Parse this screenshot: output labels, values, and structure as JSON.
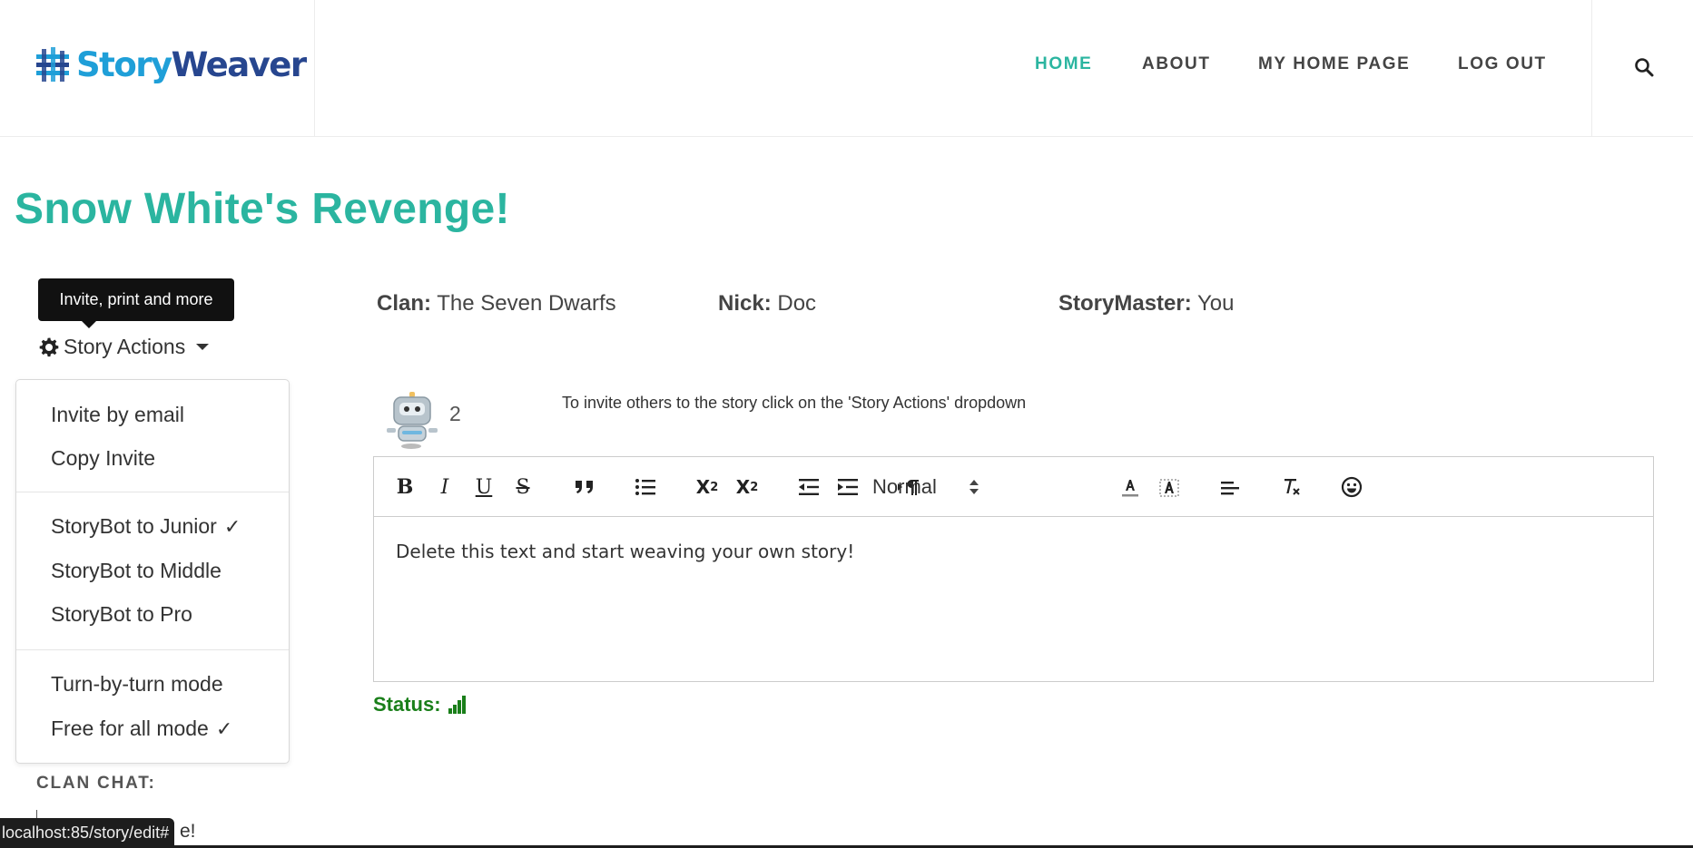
{
  "header": {
    "logo": {
      "part1": "Story",
      "part2": "Weaver"
    },
    "nav": [
      {
        "label": "HOME",
        "active": true
      },
      {
        "label": "ABOUT",
        "active": false
      },
      {
        "label": "MY HOME PAGE",
        "active": false
      },
      {
        "label": "LOG OUT",
        "active": false
      }
    ],
    "search_icon": "search-icon"
  },
  "page": {
    "title": "Snow White's Revenge!"
  },
  "tooltip": {
    "text": "Invite, print and more"
  },
  "story_actions": {
    "label": "Story Actions",
    "menu": {
      "group1": [
        "Invite by email",
        "Copy Invite"
      ],
      "group2": [
        {
          "label": "StoryBot to Junior",
          "checked": true
        },
        {
          "label": "StoryBot to Middle",
          "checked": false
        },
        {
          "label": "StoryBot to Pro",
          "checked": false
        }
      ],
      "group3": [
        {
          "label": "Turn-by-turn mode",
          "checked": false
        },
        {
          "label": "Free for all mode",
          "checked": true
        }
      ],
      "check_mark": "✓"
    }
  },
  "clan_chat": {
    "heading": "CLAN CHAT:",
    "partial_text": "e!"
  },
  "status_url": "localhost:85/story/edit#",
  "info": {
    "clan_label": "Clan:",
    "clan_value": "The Seven Dwarfs",
    "nick_label": "Nick:",
    "nick_value": "Doc",
    "master_label": "StoryMaster:",
    "master_value": "You"
  },
  "bot": {
    "count": "2",
    "icon": "robot-icon"
  },
  "invite_hint": "To invite others to the story click on the 'Story Actions' dropdown",
  "editor": {
    "toolbar": {
      "bold": "B",
      "italic": "I",
      "underline": "U",
      "strike": "S",
      "subscript_base": "X",
      "subscript_mark": "2",
      "superscript_base": "X",
      "superscript_mark": "2",
      "size_value": "Normal"
    },
    "content": "Delete this text and start weaving your own story!"
  },
  "status": {
    "label": "Status:",
    "icon": "signal-bars-icon"
  },
  "colors": {
    "accent": "#2bb5a0",
    "status": "#1a7f1a",
    "logo_light": "#1f9fd8",
    "logo_dark": "#27468f"
  }
}
